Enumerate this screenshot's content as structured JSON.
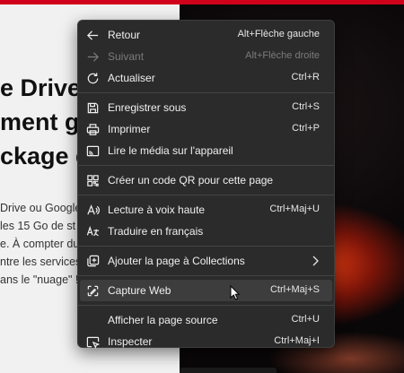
{
  "article": {
    "headline": [
      "e Drive,",
      "ment go",
      "ckage e"
    ],
    "body": [
      "Drive ou Google",
      "les 15 Go de st",
      "e. À compter du",
      "ntre les services",
      "ans le \"nuage\" !"
    ]
  },
  "menu": {
    "items": [
      {
        "icon": "arrow-left-icon",
        "label": "Retour",
        "shortcut": "Alt+Flèche gauche"
      },
      {
        "icon": "arrow-right-icon",
        "label": "Suivant",
        "shortcut": "Alt+Flèche droite",
        "disabled": true
      },
      {
        "icon": "refresh-icon",
        "label": "Actualiser",
        "shortcut": "Ctrl+R"
      },
      {
        "icon": "save-icon",
        "label": "Enregistrer sous",
        "shortcut": "Ctrl+S"
      },
      {
        "icon": "printer-icon",
        "label": "Imprimer",
        "shortcut": "Ctrl+P"
      },
      {
        "icon": "cast-icon",
        "label": "Lire le média sur l'appareil",
        "shortcut": ""
      },
      {
        "icon": "qr-code-icon",
        "label": "Créer un code QR pour cette page",
        "shortcut": ""
      },
      {
        "icon": "read-aloud-icon",
        "label": "Lecture à voix haute",
        "shortcut": "Ctrl+Maj+U"
      },
      {
        "icon": "translate-icon",
        "label": "Traduire en français",
        "shortcut": ""
      },
      {
        "icon": "collections-icon",
        "label": "Ajouter la page à Collections",
        "shortcut": ""
      },
      {
        "icon": "web-capture-icon",
        "label": "Capture Web",
        "shortcut": "Ctrl+Maj+S"
      },
      {
        "icon": "",
        "label": "Afficher la page source",
        "shortcut": "Ctrl+U"
      },
      {
        "icon": "inspect-icon",
        "label": "Inspecter",
        "shortcut": "Ctrl+Maj+I"
      }
    ]
  },
  "colors": {
    "menu_bg": "#2b2b2b",
    "hover_bg": "#3d3d3d",
    "accent_red": "#d0021b"
  }
}
